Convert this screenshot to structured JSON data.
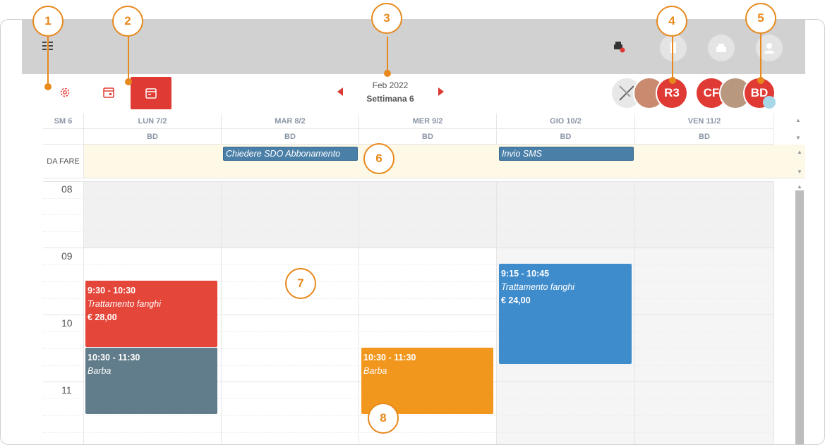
{
  "colors": {
    "accent": "#e03a34",
    "callout": "#e8891d",
    "todo": "#4a7fa8"
  },
  "header": {
    "month": "Feb 2022",
    "week": "Settimana 6",
    "avatars": [
      "R3",
      "CF",
      "BD"
    ]
  },
  "icons": [
    "menu-icon",
    "print-icon",
    "gear-icon",
    "calendar-icon",
    "calendar-week-icon",
    "prev-icon",
    "next-icon"
  ],
  "grid": {
    "week_label": "SM 6",
    "days": [
      "LUN 7/2",
      "MAR 8/2",
      "MER 9/2",
      "GIO 10/2",
      "VEN 11/2"
    ],
    "subs": [
      "BD",
      "BD",
      "BD",
      "BD",
      "BD"
    ],
    "todo_label": "DA FARE",
    "todos": [
      {
        "day": 1,
        "text": "Chiedere SDO Abbonamento"
      },
      {
        "day": 3,
        "text": "Invio SMS"
      }
    ],
    "hours": [
      "08",
      "09",
      "10",
      "11"
    ]
  },
  "events": [
    {
      "day": 0,
      "time": "9:30 - 10:30",
      "name": "Trattamento fanghi",
      "price": "€ 28,00",
      "color": "#e5463a"
    },
    {
      "day": 0,
      "time": "10:30 - 11:30",
      "name": "Barba",
      "price": "",
      "color": "#617c8a"
    },
    {
      "day": 2,
      "time": "10:30 - 11:30",
      "name": "Barba",
      "price": "",
      "color": "#f2971e"
    },
    {
      "day": 3,
      "time": "9:15 - 10:45",
      "name": "Trattamento fanghi",
      "price": "€ 24,00",
      "color": "#3f8ccc"
    }
  ],
  "callouts": [
    "1",
    "2",
    "3",
    "4",
    "5",
    "6",
    "7",
    "8"
  ]
}
